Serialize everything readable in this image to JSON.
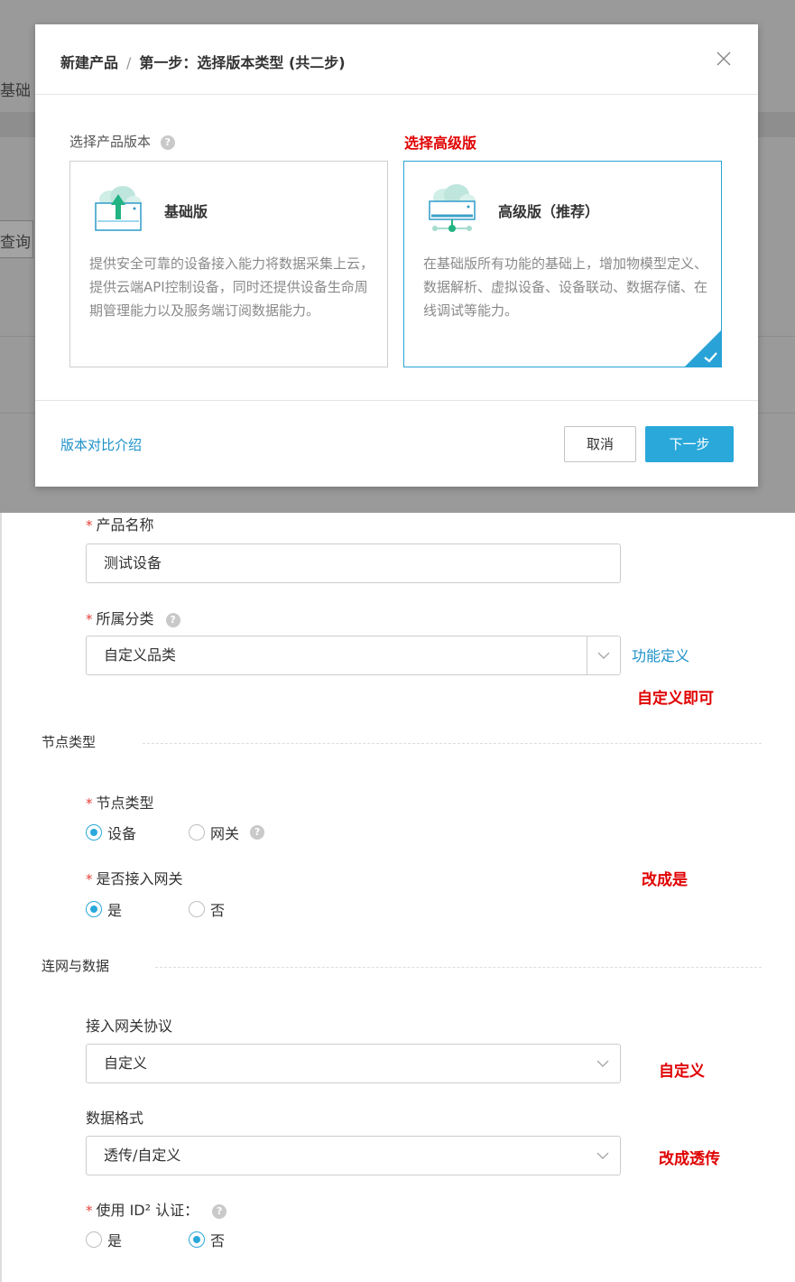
{
  "background_fragments": {
    "basic_tab_fragment": "基础",
    "query_fragment": "查询"
  },
  "modal": {
    "title_product": "新建产品",
    "title_separator": "/",
    "title_step": "第一步：选择版本类型 (共二步)",
    "section_label": "选择产品版本",
    "help_icon_text": "?",
    "cards": [
      {
        "title": "基础版",
        "description": "提供安全可靠的设备接入能力将数据采集上云，提供云端API控制设备，同时还提供设备生命周期管理能力以及服务端订阅数据能力。",
        "selected": false
      },
      {
        "title": "高级版（推荐）",
        "description": "在基础版所有功能的基础上，增加物模型定义、数据解析、虚拟设备、设备联动、数据存储、在线调试等能力。",
        "selected": true
      }
    ],
    "footer": {
      "compare_link": "版本对比介绍",
      "cancel_label": "取消",
      "next_label": "下一步"
    }
  },
  "annotations": {
    "choose_advanced": "选择高级版",
    "custom_ok": "自定义即可",
    "change_to_yes": "改成是",
    "custom": "自定义",
    "change_to_passthrough": "改成透传"
  },
  "form": {
    "required_mark": "*",
    "product_name": {
      "label": "产品名称",
      "value": "测试设备"
    },
    "category": {
      "label": "所属分类",
      "value": "自定义品类",
      "link": "功能定义"
    },
    "node_group_title": "节点类型",
    "node_type": {
      "label": "节点类型",
      "options": [
        "设备",
        "网关"
      ],
      "selected": "设备"
    },
    "gateway_access": {
      "label": "是否接入网关",
      "options": [
        "是",
        "否"
      ],
      "selected": "是"
    },
    "network_group_title": "连网与数据",
    "gateway_protocol": {
      "label": "接入网关协议",
      "value": "自定义"
    },
    "data_format": {
      "label": "数据格式",
      "value": "透传/自定义"
    },
    "id2_auth": {
      "label": "使用 ID² 认证：",
      "options": [
        "是",
        "否"
      ],
      "selected": "否"
    }
  },
  "colors": {
    "accent": "#2aa8da",
    "link": "#1e90c8",
    "annotation": "#e00000",
    "required": "#e5423b"
  }
}
